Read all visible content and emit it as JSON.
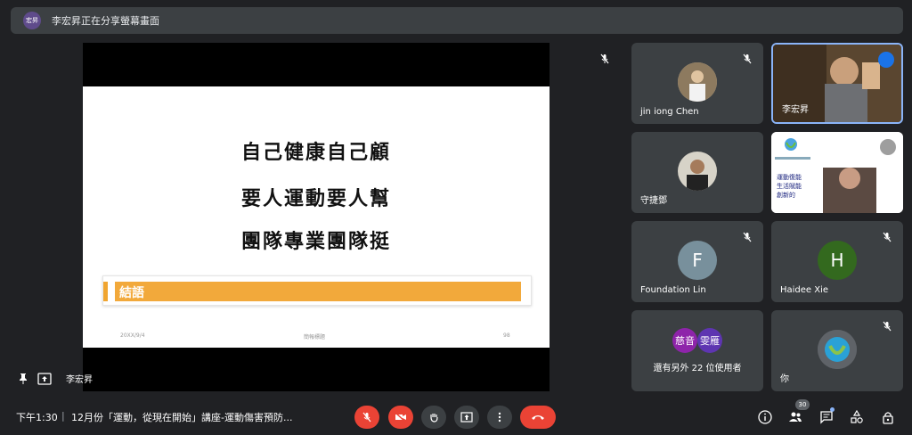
{
  "banner": {
    "avatar_text": "宏昇",
    "text": "李宏昇正在分享螢幕畫面"
  },
  "slide": {
    "line1": "自己健康自己顧",
    "line2": "要人運動要人幫",
    "line3": "團隊專業團隊挺",
    "bar_text": "結語",
    "footer_date": "20XX/9/4",
    "footer_title": "簡報標題",
    "footer_page": "98"
  },
  "presenter": {
    "name": "李宏昇"
  },
  "tiles": [
    {
      "name": "jin iong Chen",
      "muted": true
    },
    {
      "name": "李宏昇",
      "speaking": true
    },
    {
      "name": "守捷鄧",
      "muted": false
    },
    {
      "name": "",
      "muted": true
    },
    {
      "name": "Foundation Lin",
      "letter": "F",
      "color": "#78909c",
      "muted": true
    },
    {
      "name": "Haidee Xie",
      "letter": "H",
      "color": "#33691e",
      "muted": true
    },
    {
      "avatar1": "慈音",
      "avatar2": "雯雁",
      "text": "還有另外 22 位使用者"
    },
    {
      "name": "你",
      "muted": true
    }
  ],
  "tile4_logo": {
    "line1": "運動復能",
    "line2": "生活賦能",
    "line3": "創新的"
  },
  "bottom": {
    "time": "下午1:30",
    "separator": "|",
    "title": "12月份「運動，從現在開始」講座-運動傷害預防...",
    "participants_count": "30"
  },
  "colors": {
    "end_red": "#ea4335",
    "accent_orange": "#f2a93b",
    "speaking_blue": "#1a73e8"
  }
}
